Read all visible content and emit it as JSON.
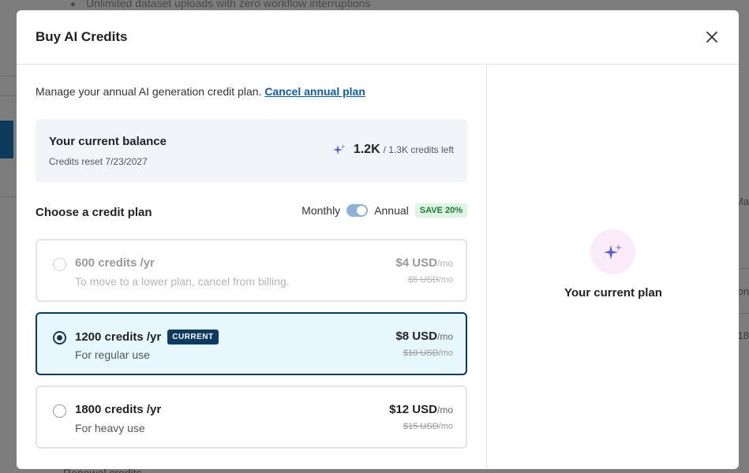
{
  "background": {
    "top_text": "Unlimited dataset uploads with zero workflow interruptions",
    "right_texts": [
      "Ma",
      "on",
      "18"
    ],
    "bottom_text": "Renewal credits"
  },
  "modal": {
    "title": "Buy AI Credits",
    "close_icon": "close-icon"
  },
  "manage": {
    "text": "Manage your annual AI generation credit plan.",
    "cancel_link": "Cancel annual plan"
  },
  "balance": {
    "title": "Your current balance",
    "reset": "Credits reset 7/23/2027",
    "value": "1.2K",
    "suffix": "/ 1.3K credits left",
    "icon": "sparkle-icon"
  },
  "plan_section": {
    "title": "Choose a credit plan",
    "monthly_label": "Monthly",
    "annual_label": "Annual",
    "save_badge": "SAVE 20%",
    "billing_annual": true
  },
  "plans": [
    {
      "name": "600 credits /yr",
      "desc": "To move to a lower plan, cancel from billing.",
      "price": "$4 USD",
      "per": "/mo",
      "old_price": "$5 USD",
      "old_per": "/mo",
      "state": "disabled"
    },
    {
      "name": "1200 credits /yr",
      "badge": "CURRENT",
      "desc": "For regular use",
      "price": "$8 USD",
      "per": "/mo",
      "old_price": "$10 USD",
      "old_per": "/mo",
      "state": "selected"
    },
    {
      "name": "1800 credits /yr",
      "desc": "For heavy use",
      "price": "$12 USD",
      "per": "/mo",
      "old_price": "$15 USD",
      "old_per": "/mo",
      "state": "available"
    }
  ],
  "right_pane": {
    "label": "Your current plan",
    "icon": "sparkle-icon"
  },
  "colors": {
    "accent": "#0b3a63",
    "link": "#0b5cab",
    "selected_bg": "#e6f7fd",
    "save_badge_bg": "#dff5e4",
    "sparkle": "#5b5fd6"
  }
}
